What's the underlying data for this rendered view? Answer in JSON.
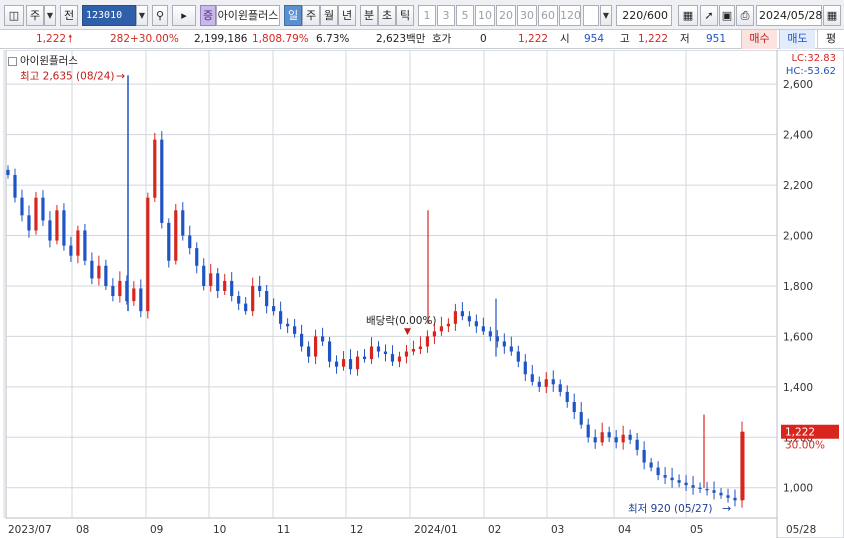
{
  "toolbar": {
    "market": "주",
    "period_prefix": "전",
    "code": "123010",
    "stock_badge": "증",
    "stock_name": "아이윈플러스",
    "period_tabs": [
      "일",
      "주",
      "월",
      "년",
      "분",
      "초",
      "틱"
    ],
    "active_period": "일",
    "intervals": [
      "1",
      "3",
      "5",
      "10",
      "20",
      "30",
      "60",
      "120"
    ],
    "count_value": "220",
    "count_total": "/600",
    "date": "2024/05/28"
  },
  "quote": {
    "price": "1,222",
    "change": "282",
    "change_rate": "+30.00%",
    "volume": "2,199,186",
    "volume_rate": "1,808.79%",
    "turnover": "6.73%",
    "amount": "2,623백만",
    "bid_label": "호가",
    "bid_value": "0",
    "bid_price": "1,222",
    "open_label": "시",
    "open": "954",
    "high_label": "고",
    "high": "1,222",
    "low_label": "저",
    "low": "951",
    "buy_button": "매수",
    "sell_button": "매도",
    "extra_button": "평"
  },
  "chart": {
    "legend": "아이윈플러스",
    "right_top": {
      "lc": "LC:32.83",
      "hc": "HC:-53.62"
    },
    "price_label": "1,222",
    "rate_label": "30.00%",
    "high_annotation": "최고 2,635 (08/24)",
    "low_annotation": "최저 920 (05/27)",
    "dividend_annotation": "배당락(0.00%)",
    "colors": {
      "up": "#d8261f",
      "down": "#1f54c4",
      "grid": "#d3d7dc"
    }
  },
  "chart_data": {
    "type": "candlestick",
    "title": "아이윈플러스",
    "y_ticks": [
      1000,
      1200,
      1400,
      1600,
      1800,
      2000,
      2200,
      2400,
      2600
    ],
    "y_tick_labels": [
      "1,000",
      "1,200",
      "1,400",
      "1,600",
      "1,800",
      "2,000",
      "2,200",
      "2,400",
      "2,600"
    ],
    "x_labels": [
      "2023/07",
      "08",
      "09",
      "10",
      "11",
      "12",
      "2024/01",
      "02",
      "03",
      "04",
      "05",
      "05/28"
    ],
    "ylim": [
      880,
      2680
    ],
    "last_close": 1222,
    "high": 2635,
    "low": 920,
    "series_close_path": [
      2240,
      2150,
      2080,
      2020,
      2150,
      2060,
      1980,
      2100,
      1960,
      1920,
      2020,
      1900,
      1830,
      1880,
      1800,
      1760,
      1820,
      1740,
      1790,
      1700,
      2150,
      2380,
      2050,
      1900,
      2100,
      2000,
      1950,
      1880,
      1800,
      1850,
      1780,
      1820,
      1760,
      1730,
      1700,
      1800,
      1780,
      1720,
      1700,
      1650,
      1640,
      1610,
      1560,
      1520,
      1600,
      1580,
      1500,
      1480,
      1510,
      1470,
      1520,
      1510,
      1560,
      1540,
      1530,
      1500,
      1520,
      1540,
      1550,
      1560,
      1600,
      1620,
      1640,
      1650,
      1700,
      1680,
      1660,
      1640,
      1620,
      1600,
      1580,
      1560,
      1540,
      1500,
      1450,
      1420,
      1400,
      1430,
      1410,
      1380,
      1340,
      1300,
      1250,
      1200,
      1180,
      1220,
      1200,
      1180,
      1210,
      1190,
      1150,
      1100,
      1080,
      1050,
      1040,
      1030,
      1020,
      1010,
      1000,
      995,
      990,
      980,
      970,
      960,
      950,
      1222
    ]
  }
}
